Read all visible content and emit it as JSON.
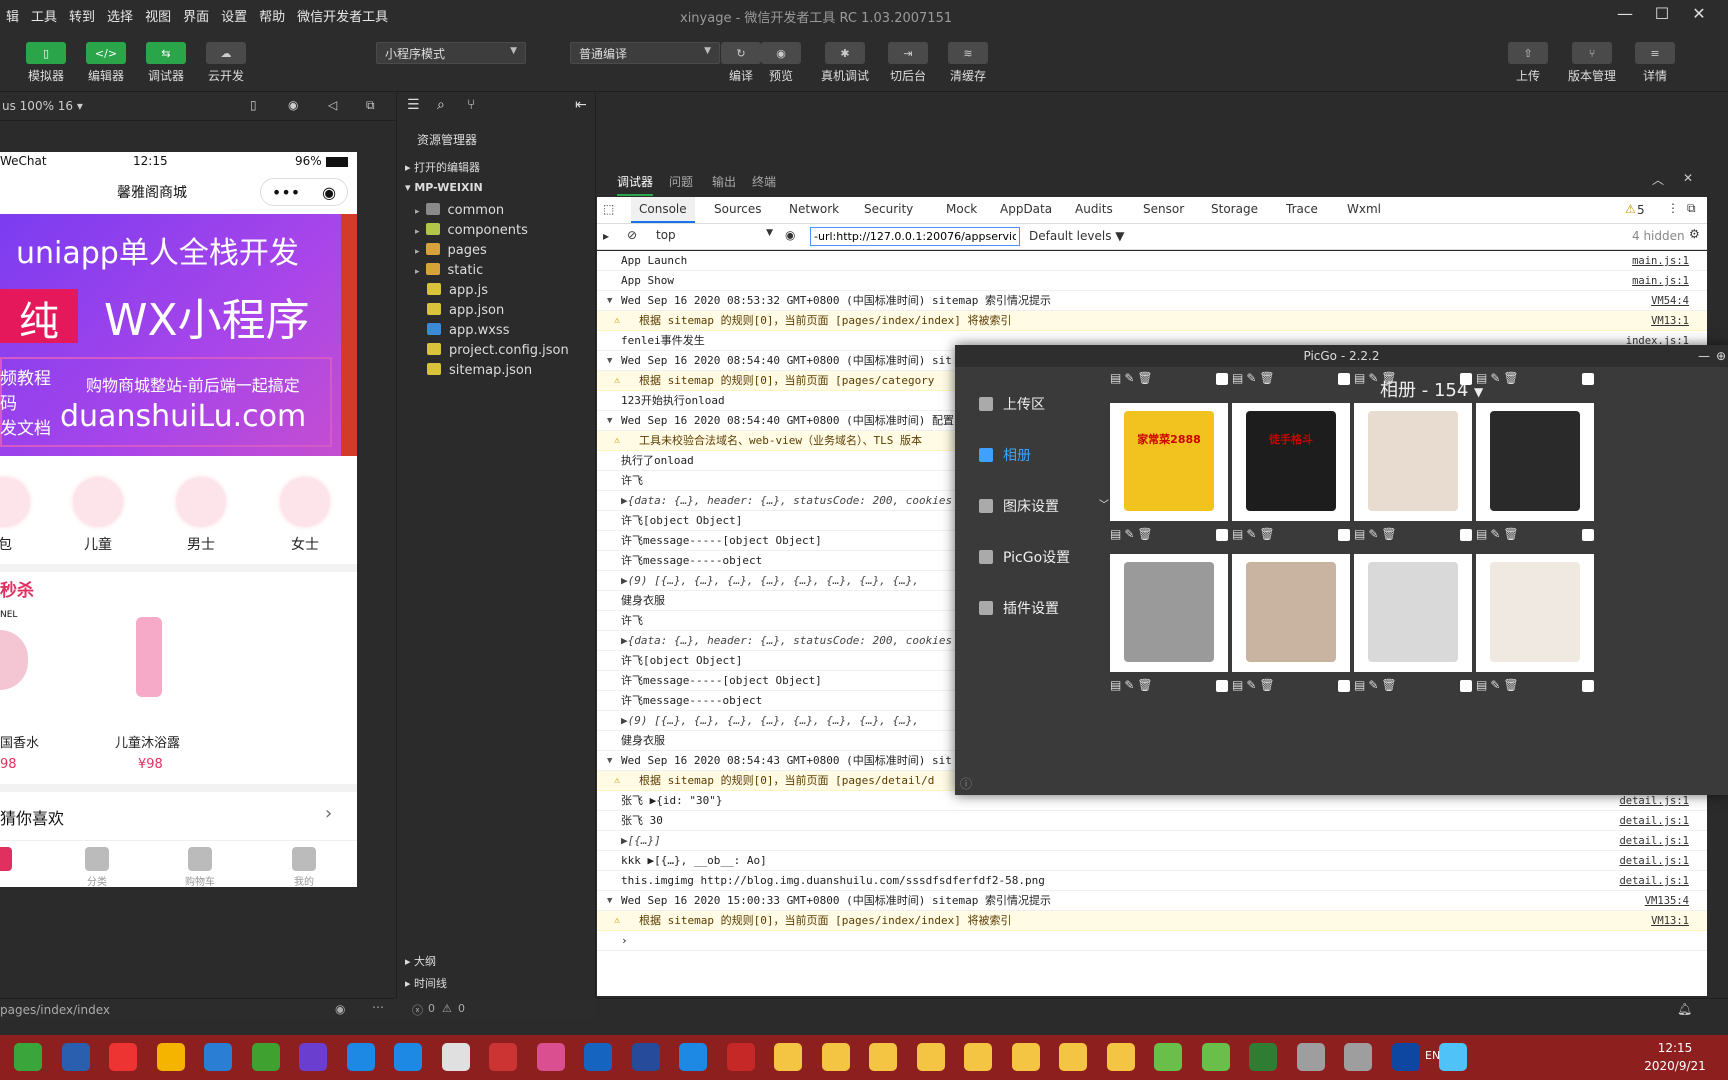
{
  "menu": [
    "辑",
    "工具",
    "转到",
    "选择",
    "视图",
    "界面",
    "设置",
    "帮助",
    "微信开发者工具"
  ],
  "window_title": "xinyage - 微信开发者工具 RC 1.03.2007151",
  "toolbar": {
    "simulator": "模拟器",
    "editor": "编辑器",
    "debugger": "调试器",
    "cloud": "云开发",
    "mode": "小程序模式",
    "compile_mode": "普通编译",
    "compile": "编译",
    "preview": "预览",
    "real_debug": "真机调试",
    "background": "切后台",
    "clear_cache": "清缓存",
    "upload": "上传",
    "version": "版本管理",
    "details": "详情"
  },
  "sim": {
    "zoom": "us 100% 16 ▾",
    "carrier": "WeChat",
    "time": "12:15",
    "battery": "96%",
    "title": "馨雅阁商城",
    "banner": {
      "line1": "uniapp单人全栈开发",
      "chip": "纯",
      "line2": "WX小程序",
      "left1": "频教程",
      "left2": "码",
      "left3": "发文档",
      "right": "购物商城整站-前后端一起搞定",
      "domain": "duanshuiLu.com"
    },
    "cats": [
      "包",
      "儿童",
      "男士",
      "女士"
    ],
    "section": "秒杀",
    "brand": "NEL",
    "products": [
      {
        "name": "国香水",
        "price": "98"
      },
      {
        "name": "儿童沐浴露",
        "price": "¥98"
      }
    ],
    "guess": "猜你喜欢",
    "tabs": [
      "",
      "分类",
      "购物车",
      "我的"
    ],
    "path": "pages/index/index"
  },
  "explorer": {
    "title": "资源管理器",
    "open_editors": "打开的编辑器",
    "project": "MP-WEIXIN",
    "items": [
      {
        "name": "common",
        "color": "#8a8a8a"
      },
      {
        "name": "components",
        "color": "#b2c44a"
      },
      {
        "name": "pages",
        "color": "#d8a23a"
      },
      {
        "name": "static",
        "color": "#d8a23a"
      },
      {
        "name": "app.js",
        "color": "#d8c33a"
      },
      {
        "name": "app.json",
        "color": "#d8c33a"
      },
      {
        "name": "app.wxss",
        "color": "#3a8ad8"
      },
      {
        "name": "project.config.json",
        "color": "#d8c33a"
      },
      {
        "name": "sitemap.json",
        "color": "#d8c33a"
      }
    ],
    "outline": "大纲",
    "timeline": "时间线",
    "errors": "0",
    "warnings": "0"
  },
  "devtools": {
    "tabs": [
      "调试器",
      "问题",
      "输出",
      "终端"
    ],
    "ctabs": [
      "Console",
      "Sources",
      "Network",
      "Security",
      "Mock",
      "AppData",
      "Audits",
      "Sensor",
      "Storage",
      "Trace",
      "Wxml"
    ],
    "warn_count": "5",
    "context": "top",
    "filter": "-url:http://127.0.0.1:20076/appservice/p",
    "levels": "Default levels ▼",
    "hidden": "4 hidden",
    "lines": [
      {
        "t": "App Launch",
        "s": "main.js:1"
      },
      {
        "t": "App Show",
        "s": "main.js:1"
      },
      {
        "t": "Wed Sep 16 2020 08:53:32 GMT+0800 (中国标准时间) sitemap 索引情况提示",
        "s": "VM54:4",
        "tri": "▼"
      },
      {
        "t": "根据 sitemap 的规则[0]，当前页面 [pages/index/index] 将被索引",
        "s": "VM13:1",
        "w": true
      },
      {
        "t": "fenlei事件发生",
        "s": "index.js:1"
      },
      {
        "t": "Wed Sep 16 2020 08:54:40 GMT+0800 (中国标准时间) sit",
        "s": "",
        "tri": "▼"
      },
      {
        "t": "根据 sitemap 的规则[0]，当前页面 [pages/category",
        "s": "",
        "w": true
      },
      {
        "t": "123开始执行onload",
        "s": ""
      },
      {
        "t": "Wed Sep 16 2020 08:54:40 GMT+0800 (中国标准时间) 配置",
        "s": "",
        "tri": "▼"
      },
      {
        "t": "工具未校验合法域名、web-view（业务域名）、TLS 版本",
        "s": "",
        "w": true
      },
      {
        "t": "执行了onload",
        "s": ""
      },
      {
        "t": "许飞",
        "s": ""
      },
      {
        "t": "▶{data: {…}, header: {…}, statusCode: 200, cookies",
        "s": "",
        "i": true
      },
      {
        "t": "许飞[object Object]",
        "s": ""
      },
      {
        "t": "许飞message-----[object Object]",
        "s": ""
      },
      {
        "t": "许飞message-----object",
        "s": ""
      },
      {
        "t": "▶(9) [{…}, {…}, {…}, {…}, {…}, {…}, {…}, {…},",
        "s": "",
        "i": true
      },
      {
        "t": "健身衣服",
        "s": ""
      },
      {
        "t": "许飞",
        "s": ""
      },
      {
        "t": "▶{data: {…}, header: {…}, statusCode: 200, cookies",
        "s": "",
        "i": true
      },
      {
        "t": "许飞[object Object]",
        "s": ""
      },
      {
        "t": "许飞message-----[object Object]",
        "s": ""
      },
      {
        "t": "许飞message-----object",
        "s": ""
      },
      {
        "t": "▶(9) [{…}, {…}, {…}, {…}, {…}, {…}, {…}, {…},",
        "s": "",
        "i": true
      },
      {
        "t": "健身衣服",
        "s": ""
      },
      {
        "t": "Wed Sep 16 2020 08:54:43 GMT+0800 (中国标准时间) sit",
        "s": "",
        "tri": "▼"
      },
      {
        "t": "根据 sitemap 的规则[0]，当前页面 [pages/detail/d",
        "s": "",
        "w": true
      },
      {
        "t": "张飞 ▶{id: \"30\"}",
        "s": "detail.js:1"
      },
      {
        "t": "张飞 30",
        "s": "detail.js:1"
      },
      {
        "t": "▶[{…}]",
        "s": "detail.js:1",
        "i": true
      },
      {
        "t": "kkk ▶[{…}, __ob__: Ao]",
        "s": "detail.js:1"
      },
      {
        "t": "this.imgimg http://blog.img.duanshuilu.com/sssdfsdferfdf2-58.png",
        "s": "detail.js:1"
      },
      {
        "t": "Wed Sep 16 2020 15:00:33 GMT+0800 (中国标准时间) sitemap 索引情况提示",
        "s": "VM135:4",
        "tri": "▼"
      },
      {
        "t": "根据 sitemap 的规则[0]，当前页面 [pages/index/index] 将被索引",
        "s": "VM13:1",
        "w": true
      },
      {
        "t": "›",
        "s": ""
      }
    ]
  },
  "picgo": {
    "title": "PicGo - 2.2.2",
    "album": "相册 - 154",
    "nav": [
      "上传区",
      "相册",
      "图床设置",
      "PicGo设置",
      "插件设置"
    ],
    "thumbs": [
      {
        "label": "家常菜2888",
        "color": "#f2c21f"
      },
      {
        "label": "徒手格斗",
        "color": "#1d1d1d"
      },
      {
        "label": "",
        "color": "#e7dccf"
      },
      {
        "label": "",
        "color": "#2a2a2a"
      },
      {
        "label": "",
        "color": "#9a9a9a"
      },
      {
        "label": "",
        "color": "#c8b4a0"
      },
      {
        "label": "",
        "color": "#d9d9d9"
      },
      {
        "label": "",
        "color": "#f0e9e2"
      }
    ]
  },
  "taskbar": {
    "time": "12:15",
    "date": "2020/9/21",
    "lang": "EN"
  }
}
